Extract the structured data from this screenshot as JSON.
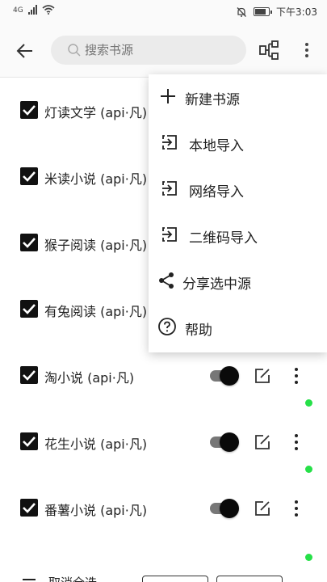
{
  "status_bar": {
    "network_text": "4G",
    "time": "下午3:03",
    "battery_level": 0.85
  },
  "toolbar": {
    "search_placeholder": "搜索书源"
  },
  "sources": [
    {
      "name": "灯读文学 (api·凡)",
      "checked": true,
      "enabled": true
    },
    {
      "name": "米读小说 (api·凡)",
      "checked": true,
      "enabled": true
    },
    {
      "name": "猴子阅读 (api·凡)",
      "checked": true,
      "enabled": true
    },
    {
      "name": "有兔阅读 (api·凡)",
      "checked": true,
      "enabled": true
    },
    {
      "name": "淘小说 (api·凡)",
      "checked": true,
      "enabled": true
    },
    {
      "name": "花生小说 (api·凡)",
      "checked": true,
      "enabled": true
    },
    {
      "name": "番薯小说 (api·凡)",
      "checked": true,
      "enabled": true
    }
  ],
  "menu": {
    "items": [
      {
        "label": "新建书源",
        "icon": "plus-icon"
      },
      {
        "label": "本地导入",
        "icon": "import-icon"
      },
      {
        "label": "网络导入",
        "icon": "import-icon"
      },
      {
        "label": "二维码导入",
        "icon": "import-icon"
      },
      {
        "label": "分享选中源",
        "icon": "share-icon"
      },
      {
        "label": "帮助",
        "icon": "help-icon"
      }
    ]
  },
  "bottom_bar": {
    "select_label": "取消全选"
  },
  "colors": {
    "accent_dot": "#26e048",
    "toggle_track": "#777777",
    "toggle_knob": "#0a0a0a"
  }
}
